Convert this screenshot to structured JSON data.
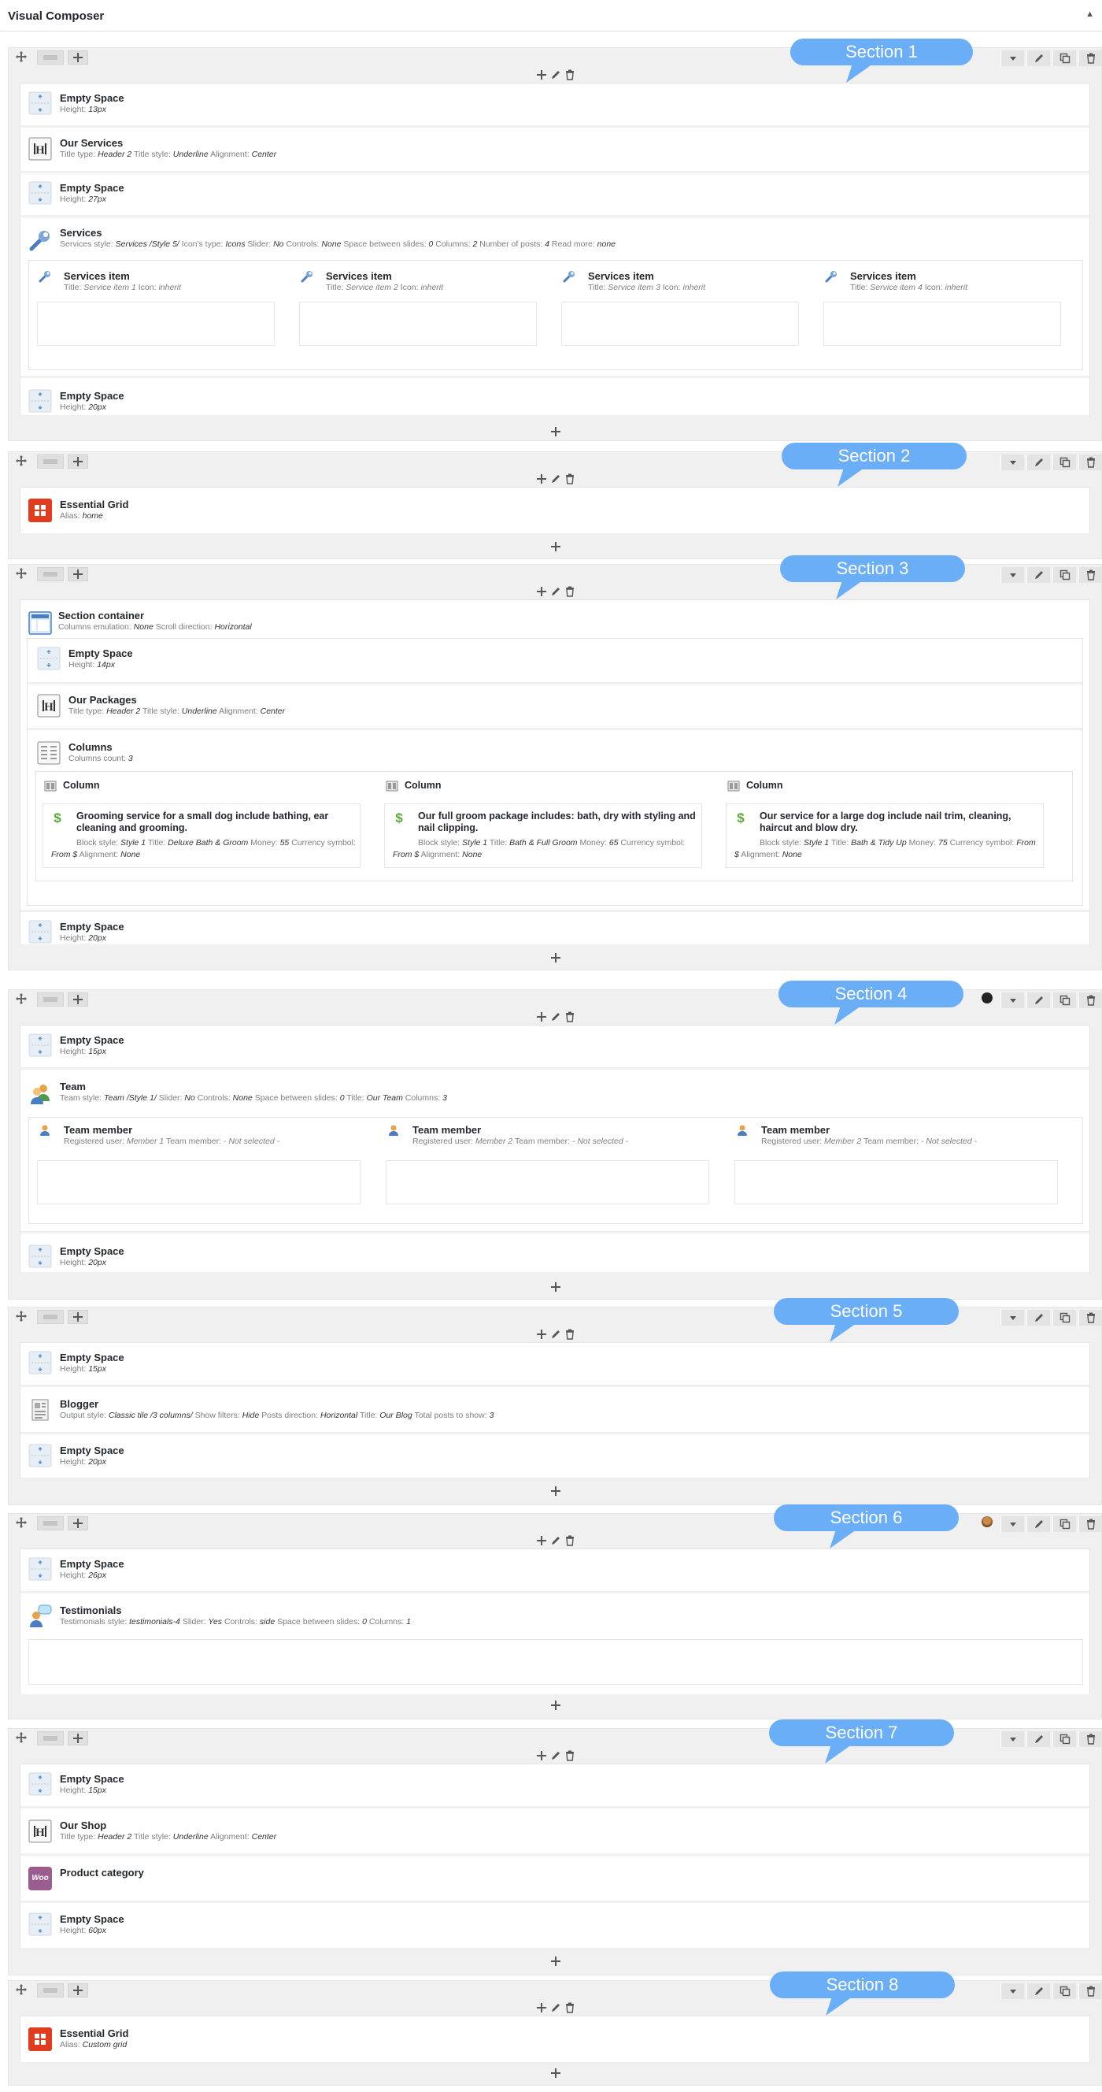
{
  "header": {
    "title": "Visual Composer",
    "toggle": "▲"
  },
  "bubbles": [
    "Section 1",
    "Section 2",
    "Section 3",
    "Section 4",
    "Section 5",
    "Section 6",
    "Section 7",
    "Section 8"
  ],
  "labels": {
    "empty_space": "Empty Space",
    "height": "Height:",
    "title_type": "Title type:",
    "title_style": "Title style:",
    "alignment": "Alignment:",
    "alias": "Alias:",
    "title": "Title:",
    "icon": "Icon:"
  },
  "s1": {
    "es1": "13px",
    "heading": {
      "name": "Our Services",
      "title_type": "Header 2",
      "title_style": "Underline",
      "alignment": "Center"
    },
    "es2": "27px",
    "services": {
      "name": "Services",
      "props": [
        [
          "Services style:",
          "Services /Style 5/"
        ],
        [
          "Icon's type:",
          "Icons"
        ],
        [
          "Slider:",
          "No"
        ],
        [
          "Controls:",
          "None"
        ],
        [
          "Space between slides:",
          "0"
        ],
        [
          "Columns:",
          "2"
        ],
        [
          "Number of posts:",
          "4"
        ],
        [
          "Read more:",
          "none"
        ]
      ]
    },
    "items": [
      {
        "name": "Services item",
        "title": "Service item 1",
        "icon": "inherit"
      },
      {
        "name": "Services item",
        "title": "Service item 2",
        "icon": "inherit"
      },
      {
        "name": "Services item",
        "title": "Service item 3",
        "icon": "inherit"
      },
      {
        "name": "Services item",
        "title": "Service item 4",
        "icon": "inherit"
      }
    ],
    "es3": "20px"
  },
  "s2": {
    "name": "Essential Grid",
    "alias": "home"
  },
  "s3": {
    "container": {
      "name": "Section container",
      "props": [
        [
          "Columns emulation:",
          "None"
        ],
        [
          "Scroll direction:",
          "Horizontal"
        ]
      ]
    },
    "es1": "14px",
    "heading": {
      "name": "Our Packages",
      "title_type": "Header 2",
      "title_style": "Underline",
      "alignment": "Center"
    },
    "columns": {
      "name": "Columns",
      "count_label": "Columns count:",
      "count": "3"
    },
    "cols": [
      {
        "name": "Column",
        "headline": "Grooming service for a small dog include bathing, ear cleaning and grooming.",
        "props": [
          [
            "Block style:",
            "Style 1"
          ],
          [
            "Title:",
            "Deluxe Bath & Groom"
          ],
          [
            "Money:",
            "55"
          ],
          [
            "Currency symbol:",
            "From $"
          ],
          [
            "Alignment:",
            "None"
          ]
        ]
      },
      {
        "name": "Column",
        "headline": "Our full groom package includes: bath, dry with styling and nail clipping.",
        "props": [
          [
            "Block style:",
            "Style 1"
          ],
          [
            "Title:",
            "Bath & Full Groom"
          ],
          [
            "Money:",
            "65"
          ],
          [
            "Currency symbol:",
            "From $"
          ],
          [
            "Alignment:",
            "None"
          ]
        ]
      },
      {
        "name": "Column",
        "headline": "Our service for a large dog include nail trim, cleaning, haircut and blow dry.",
        "props": [
          [
            "Block style:",
            "Style 1"
          ],
          [
            "Title:",
            "Bath & Tidy Up"
          ],
          [
            "Money:",
            "75"
          ],
          [
            "Currency symbol:",
            "From $"
          ],
          [
            "Alignment:",
            "None"
          ]
        ]
      }
    ],
    "es2": "20px"
  },
  "s4": {
    "es1": "15px",
    "team": {
      "name": "Team",
      "props": [
        [
          "Team style:",
          "Team /Style 1/"
        ],
        [
          "Slider:",
          "No"
        ],
        [
          "Controls:",
          "None"
        ],
        [
          "Space between slides:",
          "0"
        ],
        [
          "Title:",
          "Our Team"
        ],
        [
          "Columns:",
          "3"
        ]
      ]
    },
    "members": [
      {
        "name": "Team member",
        "user": "Member 1",
        "member": "- Not selected -"
      },
      {
        "name": "Team member",
        "user": "Member 2",
        "member": "- Not selected -"
      },
      {
        "name": "Team member",
        "user": "Member 2",
        "member": "- Not selected -"
      }
    ],
    "member_labels": [
      "Registered user:",
      "Team member:"
    ],
    "es2": "20px"
  },
  "s5": {
    "es1": "15px",
    "blogger": {
      "name": "Blogger",
      "props": [
        [
          "Output style:",
          "Classic tile /3 columns/"
        ],
        [
          "Show filters:",
          "Hide"
        ],
        [
          "Posts direction:",
          "Horizontal"
        ],
        [
          "Title:",
          "Our Blog"
        ],
        [
          "Total posts to show:",
          "3"
        ]
      ]
    },
    "es2": "20px"
  },
  "s6": {
    "es1": "26px",
    "testimonials": {
      "name": "Testimonials",
      "props": [
        [
          "Testimonials style:",
          "testimonials-4"
        ],
        [
          "Slider:",
          "Yes"
        ],
        [
          "Controls:",
          "side"
        ],
        [
          "Space between slides:",
          "0"
        ],
        [
          "Columns:",
          "1"
        ]
      ]
    }
  },
  "s7": {
    "es1": "15px",
    "heading": {
      "name": "Our Shop",
      "title_type": "Header 2",
      "title_style": "Underline",
      "alignment": "Center"
    },
    "product": {
      "name": "Product category",
      "icon_text": "Woo"
    },
    "es2": "60px"
  },
  "s8": {
    "name": "Essential Grid",
    "alias": "Custom grid"
  },
  "colors": {
    "bubble": "#6aaef8",
    "row_bg": "#f0f0f0",
    "grid_red": "#e03c1f",
    "woo": "#9b5c8f",
    "dollar": "#5aaa3a"
  }
}
